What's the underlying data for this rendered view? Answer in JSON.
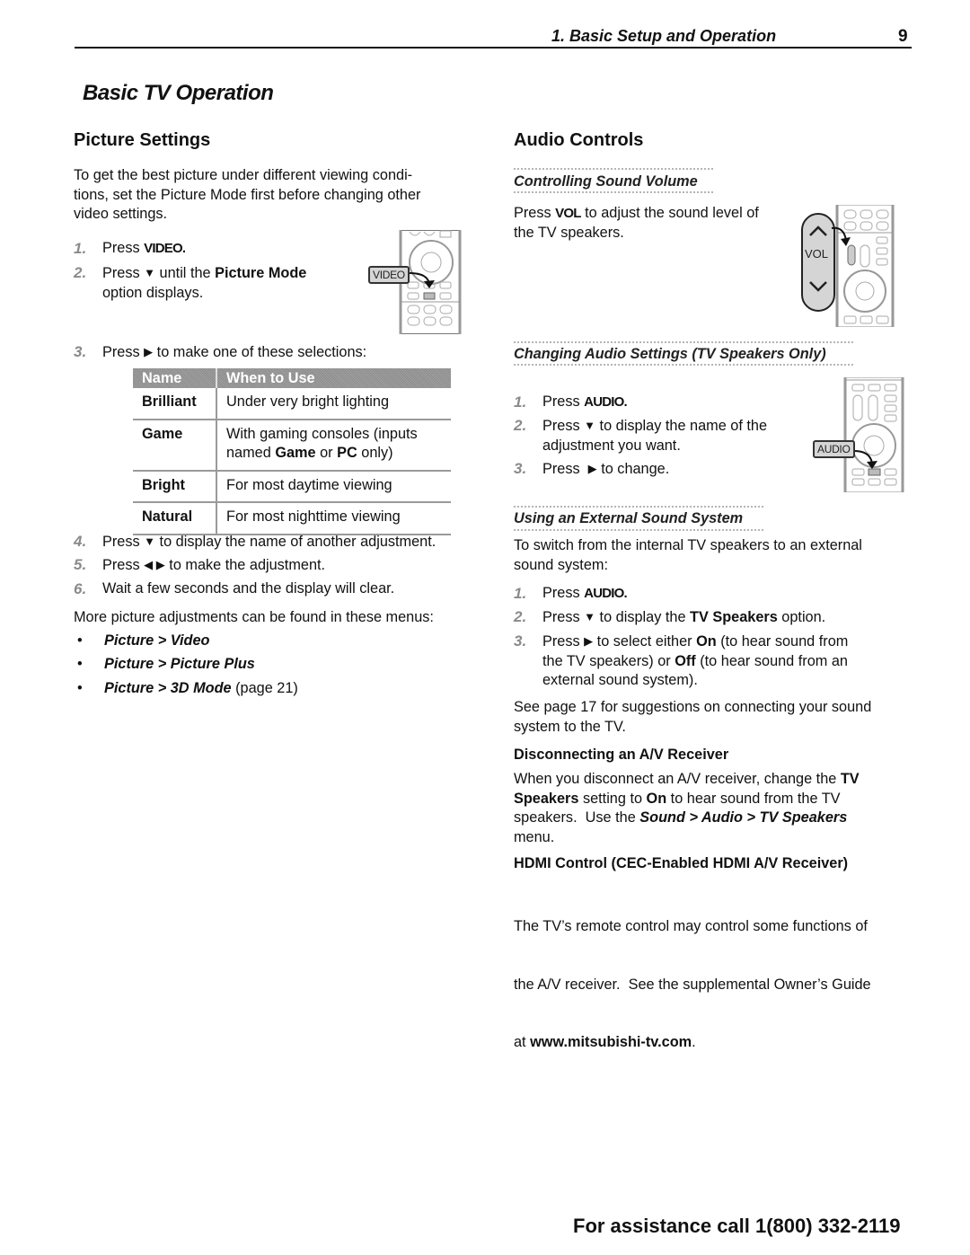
{
  "header": {
    "chapter": "1.  Basic Setup and Operation",
    "page_number": "9"
  },
  "page_title": "Basic TV Operation",
  "picture_settings": {
    "heading": "Picture Settings",
    "intro": "To get the best picture under different viewing condi-tions, set the Picture Mode first before changing other video settings.",
    "intro_lines": [
      "To get the best picture under different viewing condi-",
      "tions, set the Picture Mode first before changing other",
      "video settings."
    ],
    "steps": [
      {
        "num": "1.",
        "pre": "Press ",
        "key": "VIDEO.",
        "post": ""
      },
      {
        "num": "2.",
        "pre": "Press ",
        "arrow": "▼",
        "mid": " until the ",
        "bold": "Picture Mode",
        "post": "option displays."
      },
      {
        "num": "3.",
        "pre": "Press ",
        "arrow": "▶",
        "post": " to make one of these selections:"
      },
      {
        "num": "4.",
        "pre": "Press ",
        "arrow": "▼",
        "post": " to display the name of another adjustment."
      },
      {
        "num": "5.",
        "pre": "Press ",
        "arrow": "◀ ▶",
        "post": " to make the adjustment."
      },
      {
        "num": "6.",
        "pre": "Wait a few seconds and the display will clear.",
        "post": ""
      }
    ],
    "remote_callout": "VIDEO",
    "table": {
      "headers": [
        "Name",
        "When to Use"
      ],
      "rows": [
        {
          "name": "Brilliant",
          "use": "Under very bright lighting"
        },
        {
          "name": "Game",
          "use_pre": "With gaming consoles (inputs named ",
          "use_b1": "Game",
          "use_mid": " or ",
          "use_b2": "PC",
          "use_post": " only)"
        },
        {
          "name": "Bright",
          "use": "For most daytime viewing"
        },
        {
          "name": "Natural",
          "use": "For most nighttime viewing"
        }
      ]
    },
    "more_text": "More picture adjustments can be found in these menus:",
    "menus": [
      {
        "bullet": "•",
        "label": "Picture > Video",
        "suffix": ""
      },
      {
        "bullet": "•",
        "label": "Picture > Picture Plus",
        "suffix": ""
      },
      {
        "bullet": "•",
        "label": "Picture > 3D Mode",
        "suffix": " (page 21)"
      }
    ]
  },
  "audio_controls": {
    "heading": "Audio Controls",
    "volume": {
      "subheading": "Controlling Sound Volume",
      "pre": "Press ",
      "key": "VOL",
      "post_line1": " to adjust the sound level of",
      "line2": "the TV speakers.",
      "remote_callout": "VOL"
    },
    "changing": {
      "subheading": "Changing Audio Settings (TV Speakers Only)",
      "steps": [
        {
          "num": "1.",
          "pre": "Press ",
          "key": "AUDIO.",
          "post": ""
        },
        {
          "num": "2.",
          "pre": "Press ",
          "arrow": "▼",
          "post": " to display the name of the",
          "line2": "adjustment you want."
        },
        {
          "num": "3.",
          "pre": "Press  ",
          "arrow": "▶",
          "post": " to change."
        }
      ],
      "remote_callout": "AUDIO"
    },
    "external": {
      "subheading": "Using an External Sound System",
      "intro_lines": [
        "To switch from the internal TV speakers to an external",
        "sound system:"
      ],
      "steps": [
        {
          "num": "1.",
          "pre": "Press ",
          "key": "AUDIO.",
          "post": ""
        },
        {
          "num": "2.",
          "pre": "Press ",
          "arrow": "▼",
          "mid": " to display the ",
          "bold": "TV Speakers",
          "post": " option."
        },
        {
          "num": "3.",
          "pre": "Press ",
          "arrow": "▶",
          "mid": " to select either ",
          "bold": "On",
          "post": " (to hear sound from",
          "line2_pre": "the TV speakers) or ",
          "line2_bold": "Off",
          "line2_post": " (to hear sound from an",
          "line3": "external sound system)."
        }
      ],
      "see_lines": [
        "See page 17 for suggestions on connecting your sound",
        "system to the TV."
      ]
    },
    "disconnect": {
      "heading": "Disconnecting an A/V Receiver",
      "l1_pre": "When you disconnect an A/V receiver, change the ",
      "l1_bold": "TV",
      "l2_bold": "Speakers",
      "l2_mid": " setting to ",
      "l2_bold2": "On",
      "l2_post": " to hear sound from the TV",
      "l3_pre": "speakers.  Use the ",
      "l3_bi": "Sound > Audio > TV Speakers",
      "l4": "menu."
    },
    "hdmi": {
      "heading": "HDMI Control (CEC-Enabled HDMI A/V Receiver)",
      "l1": "The TV’s remote control may control some functions of",
      "l2": "the A/V receiver.  See the supplemental Owner’s Guide",
      "l3_pre": "at ",
      "l3_bold": "www.mitsubishi-tv.com",
      "l3_post": "."
    }
  },
  "footer": {
    "assistance": "For assistance call 1(800) 332-2119"
  }
}
